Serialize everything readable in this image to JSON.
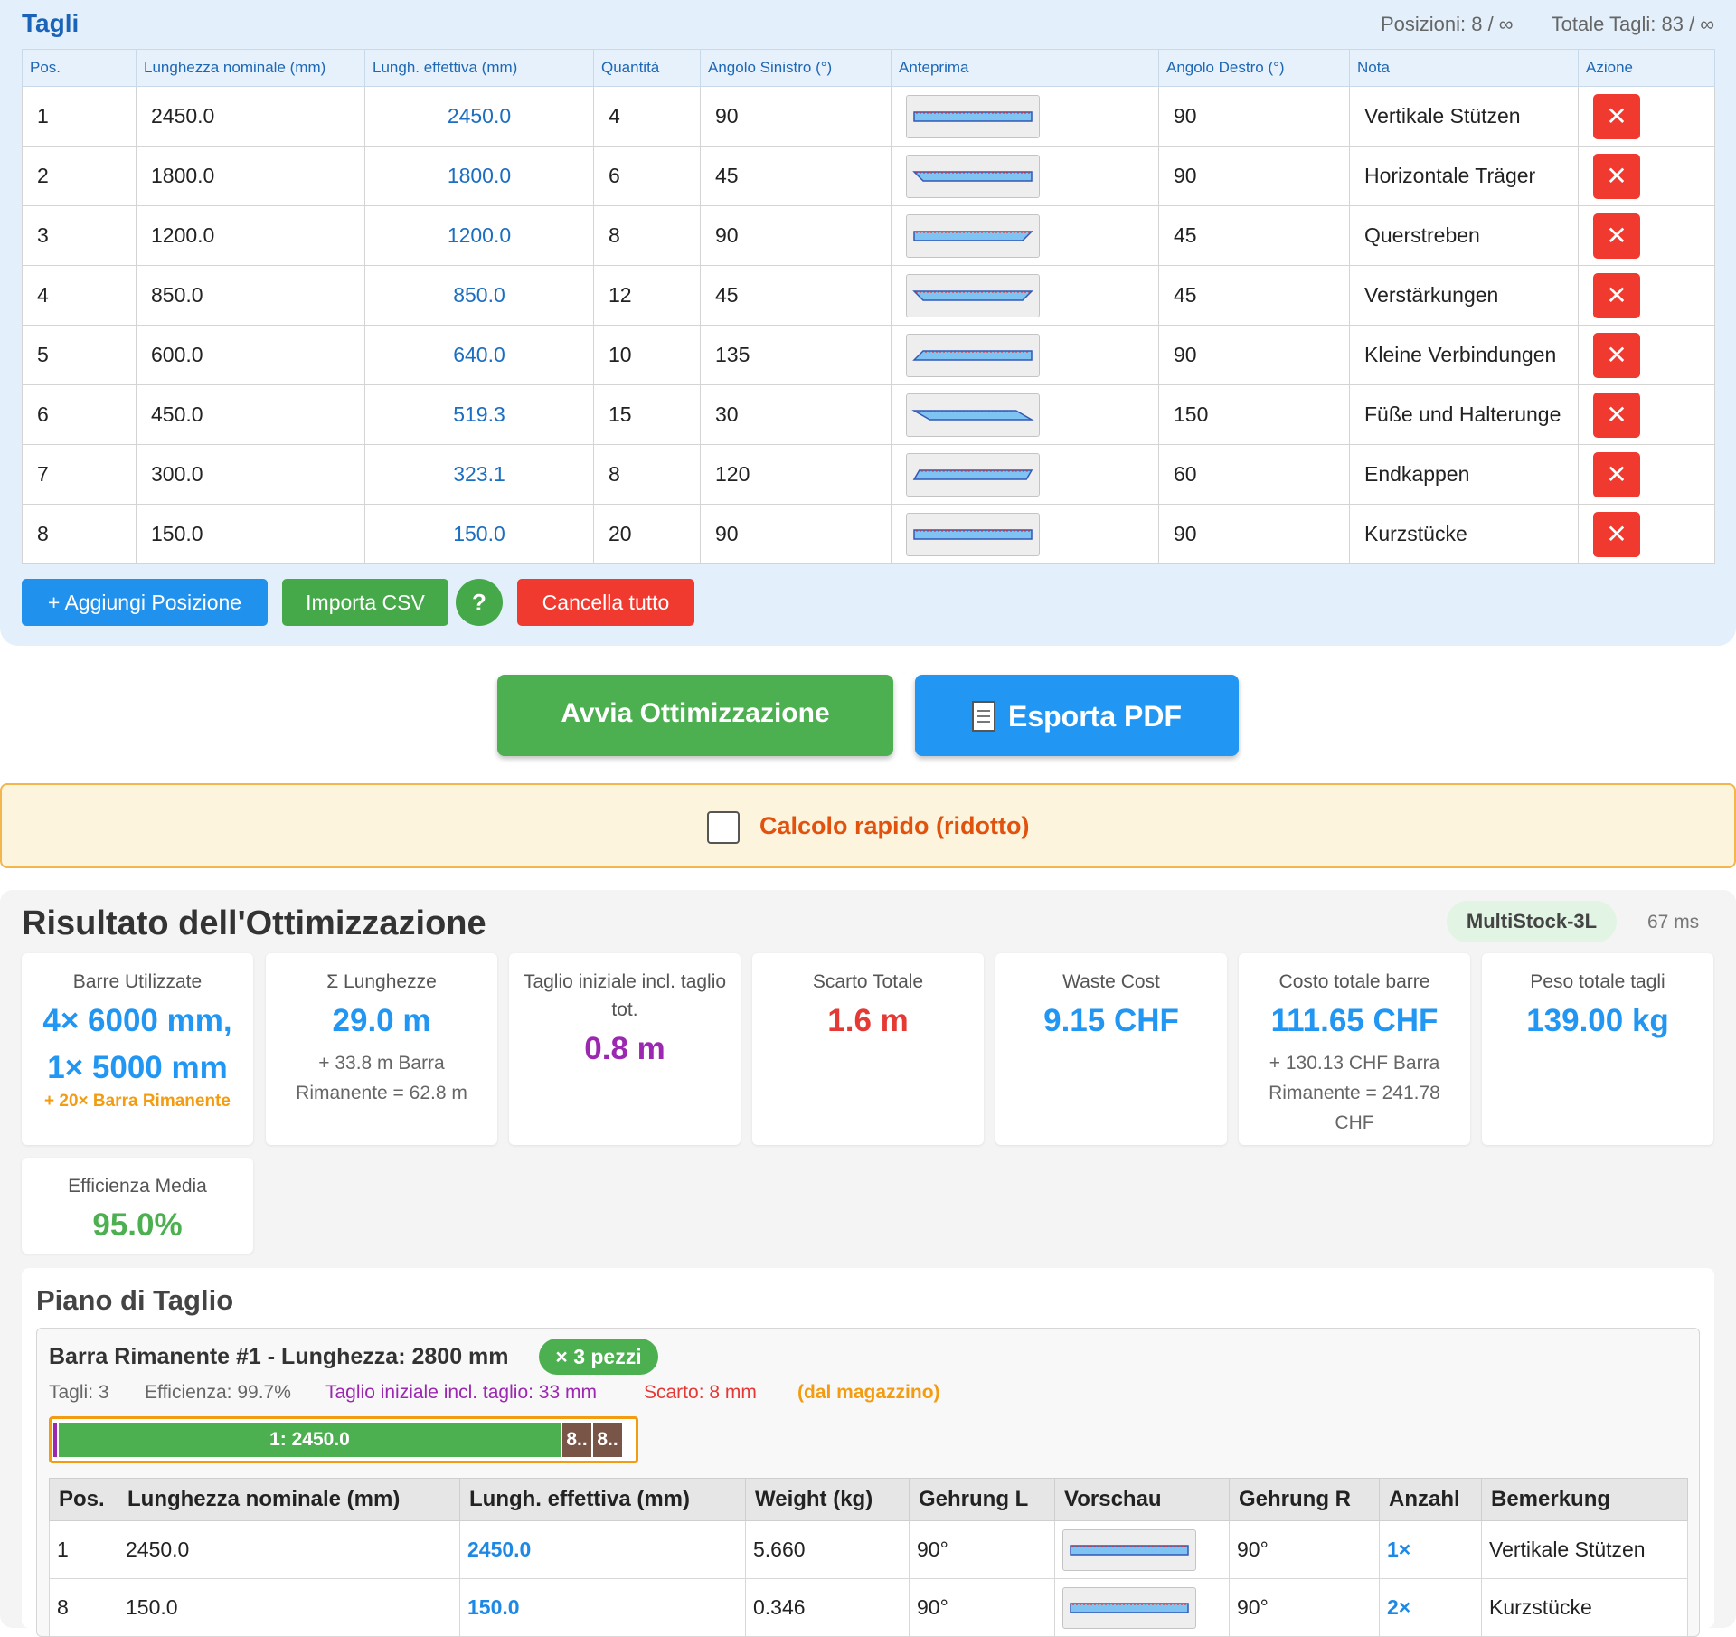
{
  "cuts_panel": {
    "title": "Tagli",
    "positions_stat": "Posizioni: 8 / ∞",
    "total_stat": "Totale Tagli: 83 / ∞",
    "headers": [
      "Pos.",
      "Lunghezza nominale (mm)",
      "Lungh. effettiva (mm)",
      "Quantità",
      "Angolo Sinistro (°)",
      "Anteprima",
      "Angolo Destro (°)",
      "Nota",
      "Azione"
    ],
    "rows": [
      {
        "pos": "1",
        "nominal": "2450.0",
        "effective": "2450.0",
        "qty": "4",
        "angle_left": "90",
        "angle_right": "90",
        "note": "Vertikale Stützen"
      },
      {
        "pos": "2",
        "nominal": "1800.0",
        "effective": "1800.0",
        "qty": "6",
        "angle_left": "45",
        "angle_right": "90",
        "note": "Horizontale Träger"
      },
      {
        "pos": "3",
        "nominal": "1200.0",
        "effective": "1200.0",
        "qty": "8",
        "angle_left": "90",
        "angle_right": "45",
        "note": "Querstreben"
      },
      {
        "pos": "4",
        "nominal": "850.0",
        "effective": "850.0",
        "qty": "12",
        "angle_left": "45",
        "angle_right": "45",
        "note": "Verstärkungen"
      },
      {
        "pos": "5",
        "nominal": "600.0",
        "effective": "640.0",
        "qty": "10",
        "angle_left": "135",
        "angle_right": "90",
        "note": "Kleine Verbindungen"
      },
      {
        "pos": "6",
        "nominal": "450.0",
        "effective": "519.3",
        "qty": "15",
        "angle_left": "30",
        "angle_right": "150",
        "note": "Füße und Halterunge"
      },
      {
        "pos": "7",
        "nominal": "300.0",
        "effective": "323.1",
        "qty": "8",
        "angle_left": "120",
        "angle_right": "60",
        "note": "Endkappen"
      },
      {
        "pos": "8",
        "nominal": "150.0",
        "effective": "150.0",
        "qty": "20",
        "angle_left": "90",
        "angle_right": "90",
        "note": "Kurzstücke"
      }
    ],
    "delete_glyph": "✕",
    "buttons": {
      "add": "+ Aggiungi Posizione",
      "import_csv": "Importa CSV",
      "help": "?",
      "clear": "Cancella tutto"
    }
  },
  "actions": {
    "run": "Avvia Ottimizzazione",
    "export_pdf": "Esporta PDF"
  },
  "quick_calc": {
    "label": "Calcolo rapido (ridotto)",
    "checked": false
  },
  "results": {
    "title": "Risultato dell'Ottimizzazione",
    "algorithm": "MultiStock-3L",
    "time": "67 ms",
    "cards": {
      "bars_used": {
        "label": "Barre Utilizzate",
        "value_line1": "4× 6000 mm,",
        "value_line2": "1× 5000 mm",
        "extra": "+ 20× Barra Rimanente"
      },
      "sum_lengths": {
        "label": "Σ Lunghezze",
        "value": "29.0 m",
        "sub": "+ 33.8 m Barra Rimanente = 62.8 m"
      },
      "initial_cut": {
        "label": "Taglio iniziale incl. taglio tot.",
        "value": "0.8 m"
      },
      "total_waste": {
        "label": "Scarto Totale",
        "value": "1.6 m"
      },
      "waste_cost": {
        "label": "Waste Cost",
        "value": "9.15 CHF"
      },
      "total_cost": {
        "label": "Costo totale barre",
        "value": "111.65 CHF",
        "sub": "+ 130.13 CHF Barra Rimanente = 241.78 CHF"
      },
      "total_weight": {
        "label": "Peso totale tagli",
        "value": "139.00 kg"
      },
      "avg_efficiency": {
        "label": "Efficienza Media",
        "value": "95.0%"
      }
    },
    "colors": {
      "blue": "#2196f3",
      "purple": "#9c27b0",
      "red": "#e53935",
      "green": "#4caf50",
      "orange": "#f39c12"
    }
  },
  "cutting_plan": {
    "title": "Piano di Taglio",
    "bar": {
      "title": "Barra Rimanente #1 - Lunghezza: 2800 mm",
      "qty_badge": "× 3 pezzi",
      "cuts": "Tagli: 3",
      "efficiency": "Efficienza: 99.7%",
      "initial_cut": "Taglio iniziale incl. taglio: 33 mm",
      "waste": "Scarto: 8 mm",
      "source": "(dal magazzino)",
      "segments": [
        {
          "label": "1: 2450.0",
          "length": 2450,
          "color": "#4caf50"
        },
        {
          "label": "8..",
          "length": 150,
          "color": "#795548"
        },
        {
          "label": "8..",
          "length": 150,
          "color": "#795548"
        }
      ]
    },
    "table": {
      "headers": [
        "Pos.",
        "Lunghezza nominale (mm)",
        "Lungh. effettiva (mm)",
        "Weight (kg)",
        "Gehrung L",
        "Vorschau",
        "Gehrung R",
        "Anzahl",
        "Bemerkung"
      ],
      "rows": [
        {
          "pos": "1",
          "nominal": "2450.0",
          "effective": "2450.0",
          "weight": "5.660",
          "miter_l": "90°",
          "miter_r": "90°",
          "count": "1×",
          "remark": "Vertikale Stützen"
        },
        {
          "pos": "8",
          "nominal": "150.0",
          "effective": "150.0",
          "weight": "0.346",
          "miter_l": "90°",
          "miter_r": "90°",
          "count": "2×",
          "remark": "Kurzstücke"
        }
      ]
    }
  }
}
